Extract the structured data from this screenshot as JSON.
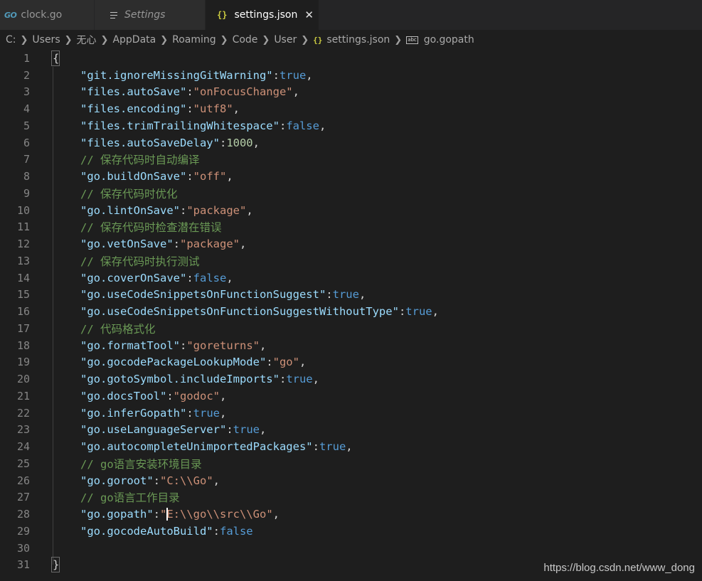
{
  "tabs": [
    {
      "icon": "go-icon",
      "icon_text": "GO",
      "label": "clock.go"
    },
    {
      "icon": "menu-icon",
      "label": "Settings"
    },
    {
      "icon": "json-icon",
      "icon_text": "{}",
      "label": "settings.json"
    }
  ],
  "breadcrumb": [
    "C:",
    "Users",
    "无心",
    "AppData",
    "Roaming",
    "Code",
    "User",
    "settings.json",
    "go.gopath"
  ],
  "breadcrumb_icons": {
    "file": "{}",
    "property": "abc"
  },
  "editor": {
    "line_numbers": [
      "1",
      "2",
      "3",
      "4",
      "5",
      "6",
      "7",
      "8",
      "9",
      "10",
      "11",
      "12",
      "13",
      "14",
      "15",
      "16",
      "17",
      "18",
      "19",
      "20",
      "21",
      "22",
      "23",
      "24",
      "25",
      "26",
      "27",
      "28",
      "29",
      "30",
      "31"
    ],
    "open_brace": "{",
    "close_brace": "}",
    "settings": [
      {
        "key": "\"git.ignoreMissingGitWarning\"",
        "colon": ":",
        "value": "true",
        "comma": ","
      },
      {
        "key": "\"files.autoSave\"",
        "colon": ":",
        "value": "\"onFocusChange\"",
        "comma": ","
      },
      {
        "key": "\"files.encoding\"",
        "colon": ":",
        "value": "\"utf8\"",
        "comma": ","
      },
      {
        "key": "\"files.trimTrailingWhitespace\"",
        "colon": ":",
        "value": "false",
        "comma": ","
      },
      {
        "key": "\"files.autoSaveDelay\"",
        "colon": ":",
        "value": "1000",
        "comma": ","
      },
      {
        "comment": "// 保存代码时自动编译"
      },
      {
        "key": "\"go.buildOnSave\"",
        "colon": ":",
        "value": "\"off\"",
        "comma": ","
      },
      {
        "comment": "// 保存代码时优化"
      },
      {
        "key": "\"go.lintOnSave\"",
        "colon": ":",
        "value": "\"package\"",
        "comma": ","
      },
      {
        "comment": "// 保存代码时检查潜在错误"
      },
      {
        "key": "\"go.vetOnSave\"",
        "colon": ":",
        "value": "\"package\"",
        "comma": ","
      },
      {
        "comment": "// 保存代码时执行测试"
      },
      {
        "key": "\"go.coverOnSave\"",
        "colon": ":",
        "value": "false",
        "comma": ","
      },
      {
        "key": "\"go.useCodeSnippetsOnFunctionSuggest\"",
        "colon": ":",
        "value": "true",
        "comma": ","
      },
      {
        "key": "\"go.useCodeSnippetsOnFunctionSuggestWithoutType\"",
        "colon": ":",
        "value": "true",
        "comma": ","
      },
      {
        "comment": "// 代码格式化"
      },
      {
        "key": "\"go.formatTool\"",
        "colon": ":",
        "value": "\"goreturns\"",
        "comma": ","
      },
      {
        "key": "\"go.gocodePackageLookupMode\"",
        "colon": ":",
        "value": "\"go\"",
        "comma": ","
      },
      {
        "key": "\"go.gotoSymbol.includeImports\"",
        "colon": ":",
        "value": "true",
        "comma": ","
      },
      {
        "key": "\"go.docsTool\"",
        "colon": ":",
        "value": "\"godoc\"",
        "comma": ","
      },
      {
        "key": "\"go.inferGopath\"",
        "colon": ":",
        "value": "true",
        "comma": ","
      },
      {
        "key": "\"go.useLanguageServer\"",
        "colon": ":",
        "value": "true",
        "comma": ","
      },
      {
        "key": "\"go.autocompleteUnimportedPackages\"",
        "colon": ":",
        "value": "true",
        "comma": ","
      },
      {
        "comment": "// go语言安装环境目录"
      },
      {
        "key": "\"go.goroot\"",
        "colon": ":",
        "value": "\"C:\\\\Go\"",
        "comma": ","
      },
      {
        "comment": "// go语言工作目录"
      },
      {
        "key": "\"go.gopath\"",
        "colon": ":",
        "value_before_cursor": "\"",
        "value_after_cursor": "E:\\\\go\\\\src\\\\Go\"",
        "comma": ",",
        "cursor": true
      },
      {
        "key": "\"go.gocodeAutoBuild\"",
        "colon": ":",
        "value": "false",
        "comma": ""
      }
    ]
  },
  "watermark": "https://blog.csdn.net/www_dong"
}
